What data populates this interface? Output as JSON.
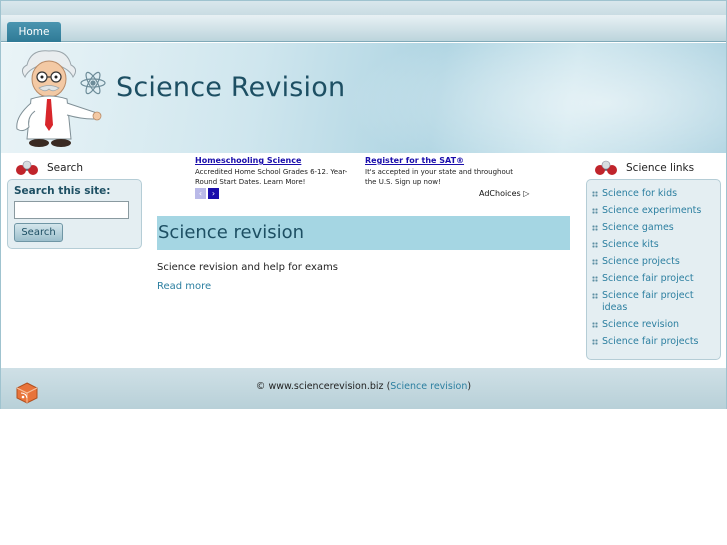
{
  "nav": {
    "home_label": "Home"
  },
  "header": {
    "site_title": "Science Revision"
  },
  "left": {
    "heading": "Search",
    "search_label": "Search this site:",
    "search_value": "",
    "search_button": "Search"
  },
  "ads": {
    "ad1": {
      "title": "Homeschooling Science",
      "text": "Accredited Home School Grades 6-12. Year-Round Start Dates. Learn More!"
    },
    "ad2": {
      "title": "Register for the SAT®",
      "text": "It's accepted in your state and throughout the U.S. Sign up now!"
    },
    "prev": "‹",
    "next": "›",
    "adchoices": "AdChoices ▷"
  },
  "main": {
    "title": "Science revision",
    "text": "Science revision and help for exams",
    "read_more": "Read more"
  },
  "right": {
    "heading": "Science links",
    "links": [
      "Science for kids",
      "Science experiments",
      "Science games",
      "Science kits",
      "Science projects",
      "Science fair project",
      "Science fair project ideas",
      "Science revision",
      "Science fair projects"
    ]
  },
  "footer": {
    "copyright": "© www.sciencerevision.biz (",
    "link": "Science revision",
    "close": ")"
  },
  "colors": {
    "accent": "#2c7fa0",
    "title_bar": "#a5d6e3",
    "dark_text": "#1d4f63"
  }
}
